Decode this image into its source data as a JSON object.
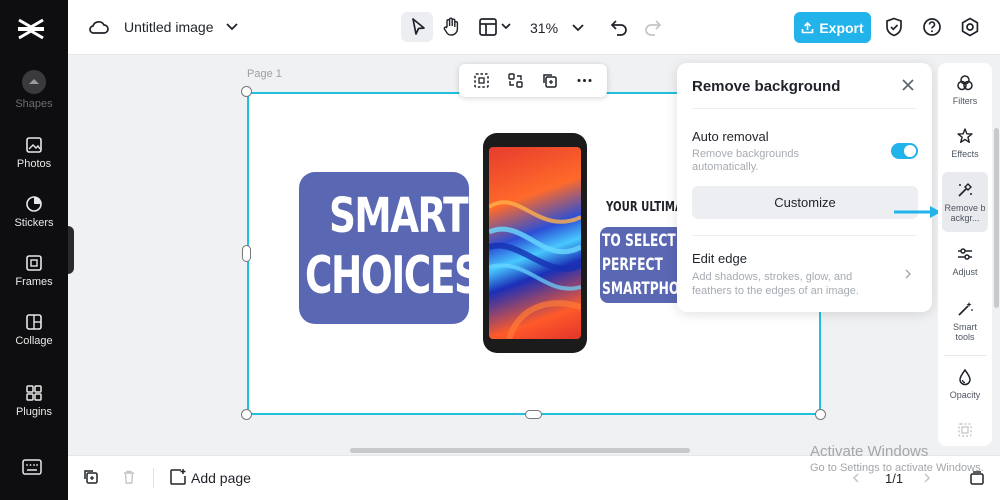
{
  "colors": {
    "accent": "#22b3ea",
    "selection": "#22c0dd",
    "tile": "#5a67b3",
    "sidebar": "#0e0e10"
  },
  "sidebar": {
    "items": [
      {
        "label": "Shapes",
        "icon": "shapes-icon"
      },
      {
        "label": "Photos",
        "icon": "image-icon"
      },
      {
        "label": "Stickers",
        "icon": "sticker-icon"
      },
      {
        "label": "Frames",
        "icon": "frame-icon"
      },
      {
        "label": "Collage",
        "icon": "collage-icon"
      },
      {
        "label": "Plugins",
        "icon": "plugins-icon"
      }
    ]
  },
  "header": {
    "title": "Untitled image",
    "zoom": "31%",
    "export_label": "Export"
  },
  "canvas": {
    "page_label": "Page 1",
    "graphic": {
      "smart_line1": "SMART",
      "smart_line2": "CHOICES",
      "tagline": "YOUR ULTIMA",
      "select_lines": [
        "TO SELECT",
        "PERFECT",
        "SMARTPHO"
      ]
    }
  },
  "panel": {
    "title": "Remove background",
    "auto_removal": {
      "title": "Auto removal",
      "description": "Remove backgrounds automatically.",
      "enabled": true
    },
    "customize_label": "Customize",
    "edit_edge": {
      "title": "Edit edge",
      "description": "Add shadows, strokes, glow, and feathers to the edges of an image."
    }
  },
  "rail": {
    "items": [
      {
        "label": "Filters",
        "icon": "filters-icon"
      },
      {
        "label": "Effects",
        "icon": "effects-icon"
      },
      {
        "label": "Remove backgr...",
        "icon": "remove-bg-icon",
        "active": true
      },
      {
        "label": "Adjust",
        "icon": "adjust-icon"
      },
      {
        "label": "Smart tools",
        "icon": "magic-wand-icon"
      },
      {
        "label": "Opacity",
        "icon": "opacity-icon"
      }
    ]
  },
  "bottom": {
    "add_page_label": "Add page",
    "page_count": "1/1"
  },
  "watermark": {
    "line1": "Activate Windows",
    "line2": "Go to Settings to activate Windows."
  }
}
